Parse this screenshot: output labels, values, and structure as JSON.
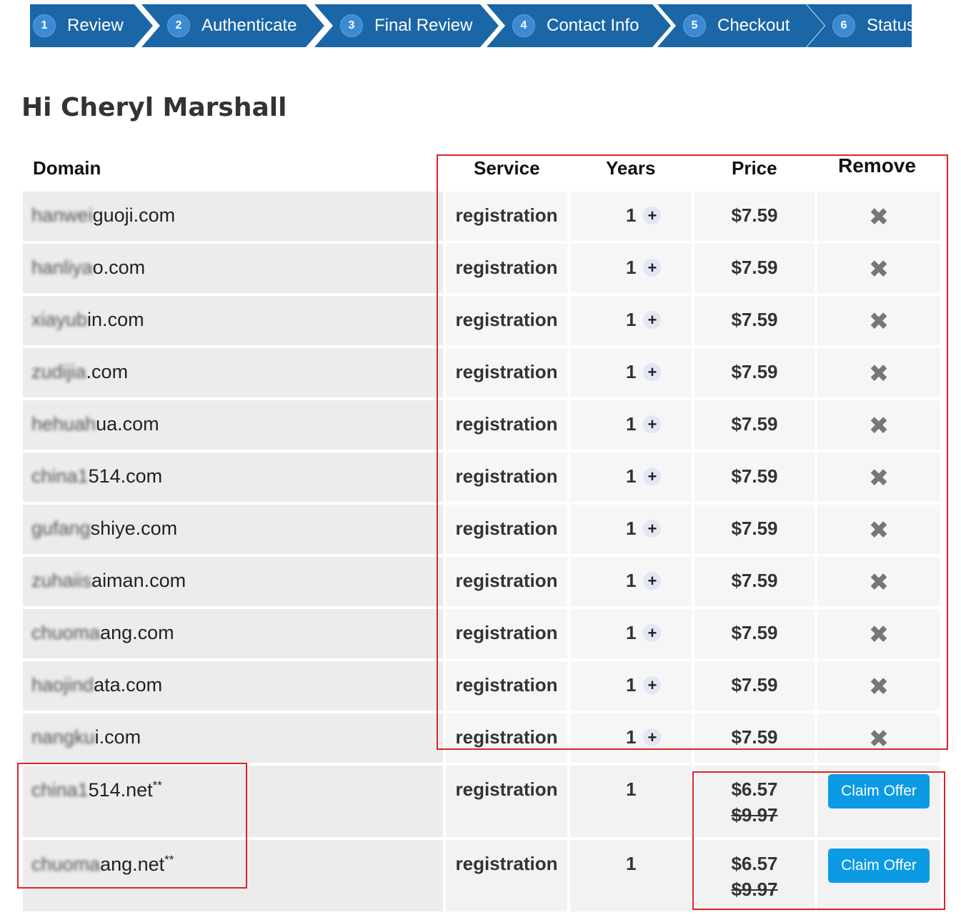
{
  "steps": [
    {
      "num": "1",
      "label": "Review"
    },
    {
      "num": "2",
      "label": "Authenticate"
    },
    {
      "num": "3",
      "label": "Final Review"
    },
    {
      "num": "4",
      "label": "Contact Info"
    },
    {
      "num": "5",
      "label": "Checkout"
    },
    {
      "num": "6",
      "label": "Status"
    }
  ],
  "greeting": "Hi Cheryl Marshall",
  "columns": {
    "domain": "Domain",
    "service": "Service",
    "years": "Years",
    "price": "Price",
    "remove": "Remove"
  },
  "rows": [
    {
      "domain_hidden": "hanwei",
      "domain_visible": "guoji.com",
      "service": "registration",
      "years": "1",
      "price": "$7.59"
    },
    {
      "domain_hidden": "hanliya",
      "domain_visible": "o.com",
      "service": "registration",
      "years": "1",
      "price": "$7.59"
    },
    {
      "domain_hidden": "xiayub",
      "domain_visible": "in.com",
      "service": "registration",
      "years": "1",
      "price": "$7.59"
    },
    {
      "domain_hidden": "zudijia",
      "domain_visible": ".com",
      "service": "registration",
      "years": "1",
      "price": "$7.59"
    },
    {
      "domain_hidden": "hehuah",
      "domain_visible": "ua.com",
      "service": "registration",
      "years": "1",
      "price": "$7.59"
    },
    {
      "domain_hidden": "china1",
      "domain_visible": "514.com",
      "service": "registration",
      "years": "1",
      "price": "$7.59"
    },
    {
      "domain_hidden": "gufang",
      "domain_visible": "shiye.com",
      "service": "registration",
      "years": "1",
      "price": "$7.59"
    },
    {
      "domain_hidden": "zuhaiis",
      "domain_visible": "aiman.com",
      "service": "registration",
      "years": "1",
      "price": "$7.59"
    },
    {
      "domain_hidden": "chuoma",
      "domain_visible": "ang.com",
      "service": "registration",
      "years": "1",
      "price": "$7.59"
    },
    {
      "domain_hidden": "haojind",
      "domain_visible": "ata.com",
      "service": "registration",
      "years": "1",
      "price": "$7.59"
    },
    {
      "domain_hidden": "nangku",
      "domain_visible": "i.com",
      "service": "registration",
      "years": "1",
      "price": "$7.59"
    }
  ],
  "offers": [
    {
      "domain_hidden": "china1",
      "domain_visible": "514.net",
      "marker": "**",
      "service": "registration",
      "years": "1",
      "price": "$6.57",
      "old_price": "$9.97",
      "button": "Claim Offer"
    },
    {
      "domain_hidden": "chuoma",
      "domain_visible": "ang.net",
      "marker": "**",
      "service": "registration",
      "years": "1",
      "price": "$6.57",
      "old_price": "$9.97",
      "button": "Claim Offer"
    }
  ],
  "icons": {
    "add_year": "plus-icon",
    "remove": "close-icon"
  },
  "colors": {
    "stepper": "#1a66a6",
    "claim_button": "#0b9ae4",
    "highlight": "#d9252a"
  }
}
